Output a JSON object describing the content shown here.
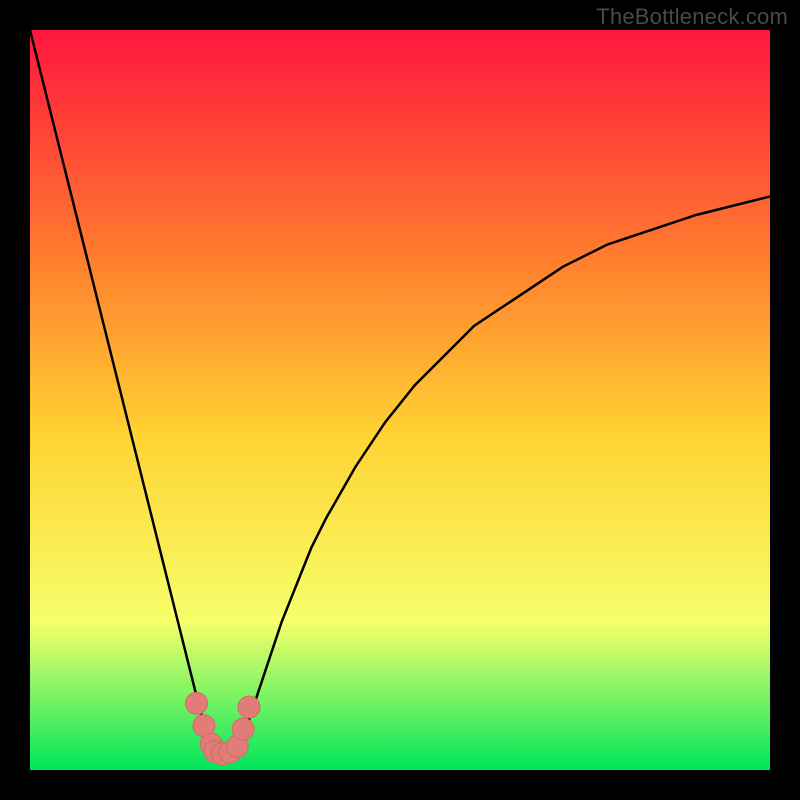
{
  "watermark": "TheBottleneck.com",
  "colors": {
    "background": "#000000",
    "gradient_top": "#ff163e",
    "gradient_mid_upper": "#ff7a2e",
    "gradient_mid": "#ffd333",
    "gradient_lower": "#f6ff6a",
    "gradient_bottom": "#00e65c",
    "curve": "#000000",
    "marker_fill": "#e07d78",
    "marker_stroke": "#d46a65"
  },
  "chart_data": {
    "type": "line",
    "title": "",
    "xlabel": "",
    "ylabel": "",
    "xlim": [
      0,
      100
    ],
    "ylim": [
      0,
      100
    ],
    "series": [
      {
        "name": "bottleneck-curve",
        "x": [
          0,
          2,
          4,
          6,
          8,
          10,
          12,
          14,
          16,
          18,
          20,
          22,
          23,
          24,
          25,
          26,
          27,
          28,
          29,
          30,
          32,
          34,
          36,
          38,
          40,
          44,
          48,
          52,
          56,
          60,
          66,
          72,
          78,
          84,
          90,
          96,
          100
        ],
        "y": [
          100,
          92,
          84,
          76,
          68,
          60,
          52,
          44,
          36,
          28,
          20,
          12,
          8,
          5,
          3,
          2,
          2,
          3,
          5,
          8,
          14,
          20,
          25,
          30,
          34,
          41,
          47,
          52,
          56,
          60,
          64,
          68,
          71,
          73,
          75,
          76.5,
          77.5
        ]
      }
    ],
    "markers": {
      "name": "highlighted-points",
      "x": [
        22.5,
        23.5,
        24.5,
        25.0,
        26.0,
        27.0,
        28.0,
        28.8,
        29.6
      ],
      "y": [
        9.0,
        6.0,
        3.5,
        2.5,
        2.2,
        2.4,
        3.2,
        5.5,
        8.5
      ]
    }
  }
}
